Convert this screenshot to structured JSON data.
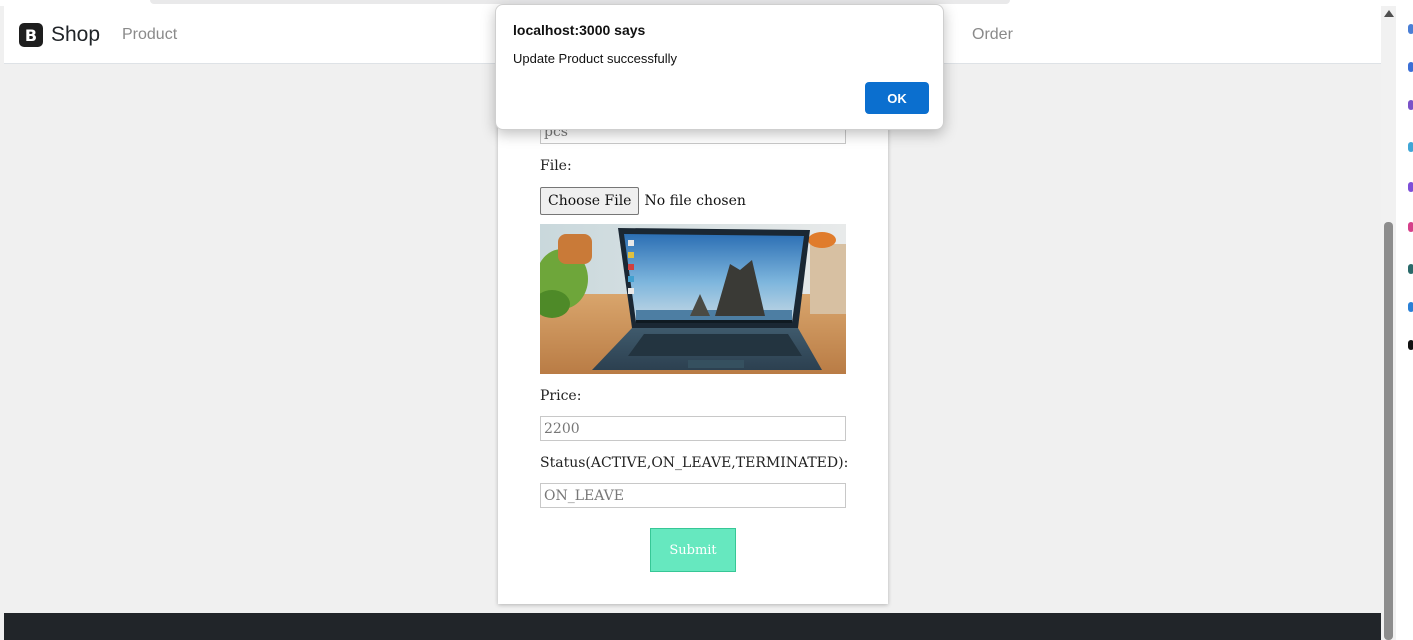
{
  "navbar": {
    "brand_logo": "B",
    "brand_name": "Shop",
    "links": [
      "Product",
      "Order"
    ]
  },
  "form": {
    "unit_value": "pcs",
    "file_label": "File:",
    "choose_file_label": "Choose File",
    "file_status": "No file chosen",
    "price_label": "Price:",
    "price_value": "2200",
    "status_label": "Status(ACTIVE,ON_LEAVE,TERMINATED):",
    "status_value": "ON_LEAVE",
    "submit_label": "Submit"
  },
  "dialog": {
    "title": "localhost:3000 says",
    "message": "Update Product successfully",
    "ok_label": "OK"
  },
  "colors": {
    "navbar_bg": "#ffffff",
    "footer_bg": "#212529",
    "submit_bg": "#66e8bf",
    "ok_button_bg": "#0b6fcf"
  },
  "icons": {
    "brand": "bootstrap-logo-icon",
    "scroll_up": "scroll-up-arrow-icon"
  }
}
